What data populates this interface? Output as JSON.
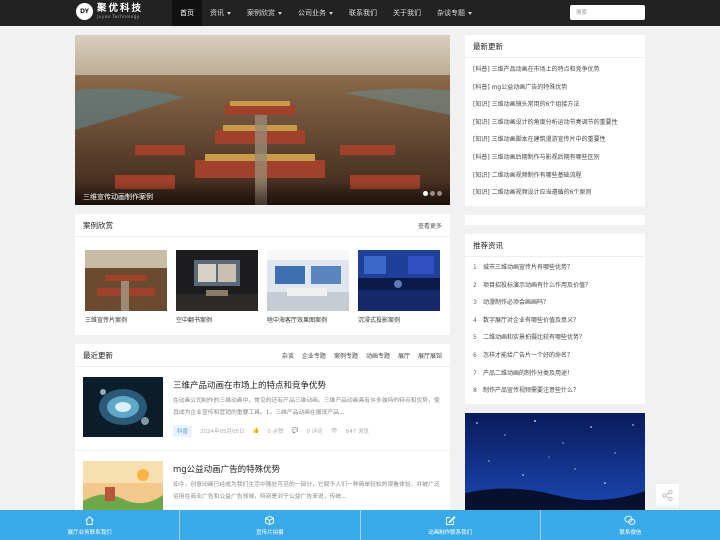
{
  "brand": {
    "mark": "DY",
    "name_cn": "聚优科技",
    "name_en": "Juyou Technology"
  },
  "nav": {
    "items": [
      {
        "label": "首页",
        "active": true,
        "dropdown": false
      },
      {
        "label": "资讯",
        "dropdown": true
      },
      {
        "label": "案例欣赏",
        "dropdown": true
      },
      {
        "label": "公司业务",
        "dropdown": true
      },
      {
        "label": "联系我们",
        "dropdown": false
      },
      {
        "label": "关于我们",
        "dropdown": false
      },
      {
        "label": "杂谈专题",
        "dropdown": true
      }
    ],
    "search_placeholder": "搜索"
  },
  "banner": {
    "caption": "三维宣传动画制作案例",
    "slide_count": 3,
    "active_slide": 1
  },
  "cases": {
    "title": "案例欣赏",
    "more": "查看更多",
    "items": [
      {
        "label": "三维宣传片案例"
      },
      {
        "label": "空中翻书案例"
      },
      {
        "label": "啥中海客厅效果图案例"
      },
      {
        "label": "沉浸式投影案例"
      }
    ]
  },
  "recent": {
    "title": "最近更新",
    "tabs": [
      "杂谈",
      "企业专题",
      "案例专题",
      "动画专题",
      "展厅",
      "展厅展馆"
    ],
    "posts": [
      {
        "title": "三维产品动画在市场上的特点和竞争优势",
        "excerpt": "在动画公司制作的三维动画中，常见的还有产品三维动画。三维产品动画具有许多独特的特点和优势，使其成为企业宣传和营销的重要工具。1，三维产品动画在展现产品...",
        "tag": "科普",
        "date": "2024年05月05日",
        "likes": "0 点赞",
        "comments": "0 评论",
        "views": "647 浏览"
      },
      {
        "title": "mg公益动画广告的特殊优势",
        "excerpt": "如今，创意动画已经成为我们生活中随处可见的一部分，它赋予人们一种简单轻松的观看体验，并被广泛运用在商业广告和公益广告领域，特别是对于公益广告来说，传统..."
      }
    ]
  },
  "latest": {
    "title": "最新更新",
    "items": [
      "[科普] 三维产品动画在市场上的特点和竞争优势",
      "[科普] mg公益动画广告的特殊优势",
      "[知识] 三维动画镜头常用的6个组接方法",
      "[知识] 三维动画设计的角度分析运动节奏调节的重要性",
      "[知识] 三维动画脚本在建筑漫游宣传片中的重要性",
      "[科普] 三维动画后期制作与影视后期有哪些区别",
      "[知识] 二维动画视频制作有哪些基础流程",
      "[知识] 二维动画视频设计应当遵循的6个原则"
    ]
  },
  "recommend": {
    "title": "推荐资讯",
    "items": [
      {
        "num": "1",
        "text": "城市三维动画宣传片有哪些优势？"
      },
      {
        "num": "2",
        "text": "项目招投标演示动画有什么作用及价值？"
      },
      {
        "num": "3",
        "text": "动漫制作必须会画画吗？"
      },
      {
        "num": "4",
        "text": "数字展厅对企业有哪些价值及意义？"
      },
      {
        "num": "5",
        "text": "二维动画和实景拍摄比较有哪些优势？"
      },
      {
        "num": "6",
        "text": "怎样才能给广告片一个好的命名？"
      },
      {
        "num": "7",
        "text": "产品二维动画的制作分类及用途！"
      },
      {
        "num": "8",
        "text": "制作产品宣传视频需要注意些什么？"
      }
    ]
  },
  "bottombar": {
    "items": [
      {
        "label": "展厅业务联系我们",
        "icon": "home-icon"
      },
      {
        "label": "宣传片拍摄",
        "icon": "cube-icon"
      },
      {
        "label": "动画制作联系我们",
        "icon": "edit-icon"
      },
      {
        "label": "联系微信",
        "icon": "wechat-icon"
      }
    ]
  },
  "colors": {
    "nav_bg": "#222222",
    "accent": "#3aa9e8",
    "page_bg": "#f1f1f1"
  }
}
